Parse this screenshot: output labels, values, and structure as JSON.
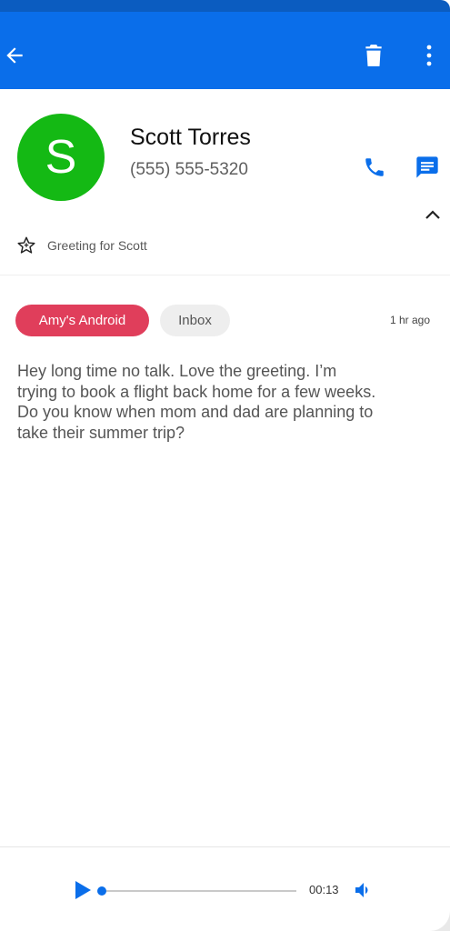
{
  "contact": {
    "initial": "S",
    "name": "Scott Torres",
    "phone": "(555) 555-5320",
    "avatar_color": "#14b914"
  },
  "greeting": {
    "label": "Greeting for Scott",
    "icon": "star-outline-icon"
  },
  "message": {
    "device_label": "Amy's Android",
    "folder_label": "Inbox",
    "time_ago": "1 hr ago",
    "transcript": "Hey long time no talk. Love the greeting. I’m trying to book a flight back home for a few weeks. Do you know when mom and dad are planning to take their summer trip?"
  },
  "player": {
    "elapsed": "00:13",
    "progress": 0.0
  },
  "icons": {
    "back": "arrow-left-icon",
    "delete": "trash-icon",
    "more": "more-vertical-icon",
    "call": "phone-icon",
    "message": "chat-icon",
    "collapse": "chevron-up-icon",
    "play": "play-icon",
    "volume": "volume-icon"
  },
  "colors": {
    "accent": "#0a6eea",
    "device_chip": "#e03e5b",
    "folder_chip": "#eeeeee"
  }
}
